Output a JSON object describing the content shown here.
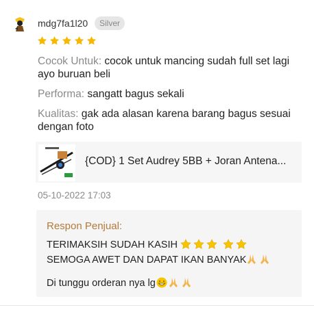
{
  "review": {
    "username": "mdg7fa1l20",
    "badge": "Silver",
    "rating": 5,
    "fields": [
      {
        "key": "Cocok Untuk:",
        "value": "cocok untuk mancing sudah full set lagi ayo buruan beli"
      },
      {
        "key": "Performa:",
        "value": "sangatt bagus sekali"
      },
      {
        "key": "Kualitas:",
        "value": "gak ada alasan karena barang bagus sesuai dengan foto"
      }
    ],
    "product_title": "{COD} 1 Set Audrey 5BB + Joran Antena...",
    "date": "05-10-2022 17:03"
  },
  "seller_reply": {
    "label": "Respon Penjual:",
    "line1": "TERIMAKSIH  SUDAH KASIH",
    "line2": "SEMOGA AWET DAN DAPAT IKAN BANYAK",
    "line3": "Di tunggu orderan nya lg"
  },
  "colors": {
    "star": "#f6b800",
    "key_text": "#8a8a8a",
    "reply_label": "#b47a3a"
  },
  "icons": {
    "avatar": "avatar-icon",
    "star": "star-icon",
    "praying_hands": "praying-hands-icon",
    "grin": "grin-emoji-icon"
  }
}
